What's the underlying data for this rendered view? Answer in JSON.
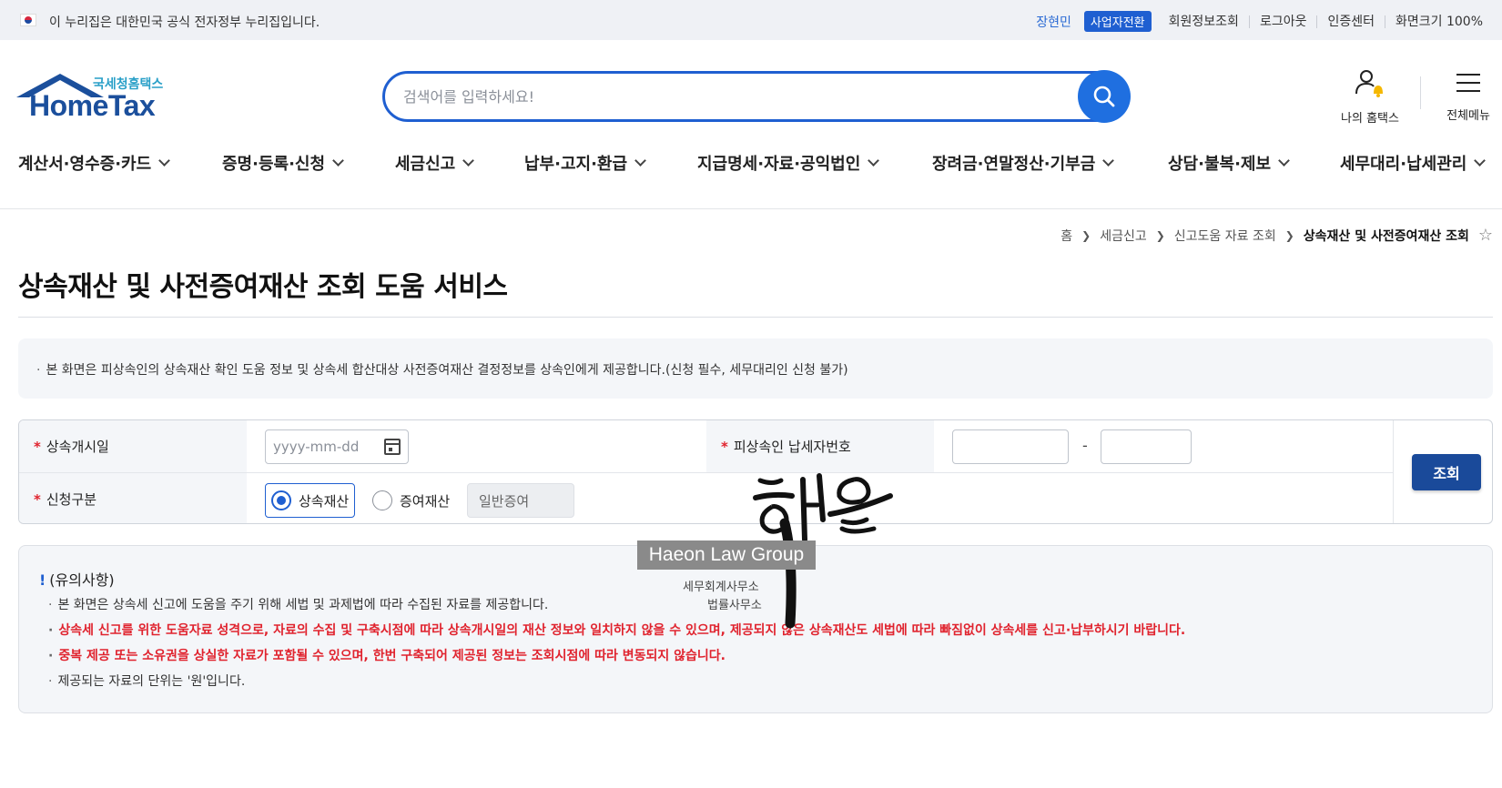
{
  "gov_bar": {
    "text": "이 누리집은 대한민국 공식 전자정부 누리집입니다.",
    "user_name": "장현민",
    "switch_badge": "사업자전환",
    "links": [
      "회원정보조회",
      "로그아웃",
      "인증센터",
      "화면크기 100%"
    ]
  },
  "header": {
    "logo_small": "국세청홈택스",
    "logo_main": "HomeTax",
    "search_placeholder": "검색어를 입력하세요!",
    "my_hometax": "나의 홈택스",
    "all_menu": "전체메뉴"
  },
  "gnb": [
    "계산서·영수증·카드",
    "증명·등록·신청",
    "세금신고",
    "납부·고지·환급",
    "지급명세·자료·공익법인",
    "장려금·연말정산·기부금",
    "상담·불복·제보",
    "세무대리·납세관리"
  ],
  "breadcrumb": [
    "홈",
    "세금신고",
    "신고도움 자료 조회",
    "상속재산 및 사전증여재산 조회"
  ],
  "page_title": "상속재산 및 사전증여재산 조회 도움 서비스",
  "notice": "본 화면은 피상속인의 상속재산 확인 도움 정보 및 상속세 합산대상 사전증여재산 결정정보를 상속인에게 제공합니다.(신청 필수, 세무대리인 신청 불가)",
  "form": {
    "start_date_label": "상속개시일",
    "start_date_placeholder": "yyyy-mm-dd",
    "tin_label": "피상속인 납세자번호",
    "tin_separator": "-",
    "type_label": "신청구분",
    "options": [
      "상속재산",
      "증여재산"
    ],
    "selected_option": "상속재산",
    "disabled_field": "일반증여",
    "query_button": "조회"
  },
  "caution": {
    "title_mark": "!",
    "title": "(유의사항)",
    "lines": [
      {
        "text": "본 화면은 상속세 신고에 도움을 주기 위해 세법 및 과제법에 따라 수집된 자료를 제공합니다.",
        "style": "normal"
      },
      {
        "text": "상속세 신고를 위한 도움자료 성격으로, 자료의 수집 및 구축시점에 따라 상속개시일의 재산 정보와 일치하지 않을 수 있으며, 제공되지 않은 상속재산도 세법에 따라 빠짐없이 상속세를 신고·납부하시기 바랍니다.",
        "style": "red"
      },
      {
        "text": "중복 제공 또는 소유권을 상실한 자료가 포함될 수 있으며, 한번 구축되어 제공된 정보는 조회시점에 따라 변동되지 않습니다.",
        "style": "red"
      },
      {
        "text": "제공되는 자료의 단위는 '원'입니다.",
        "style": "normal"
      }
    ]
  },
  "watermark": {
    "box_text": "Haeon Law Group",
    "sub1": "세무회계사무소",
    "sub2": "법률사무소",
    "calligraphy": "해온"
  },
  "colors": {
    "primary": "#1f5fd1",
    "navy_button": "#1a4a9a",
    "warning_red": "#e0232e",
    "panel_bg": "#f4f6f9"
  }
}
